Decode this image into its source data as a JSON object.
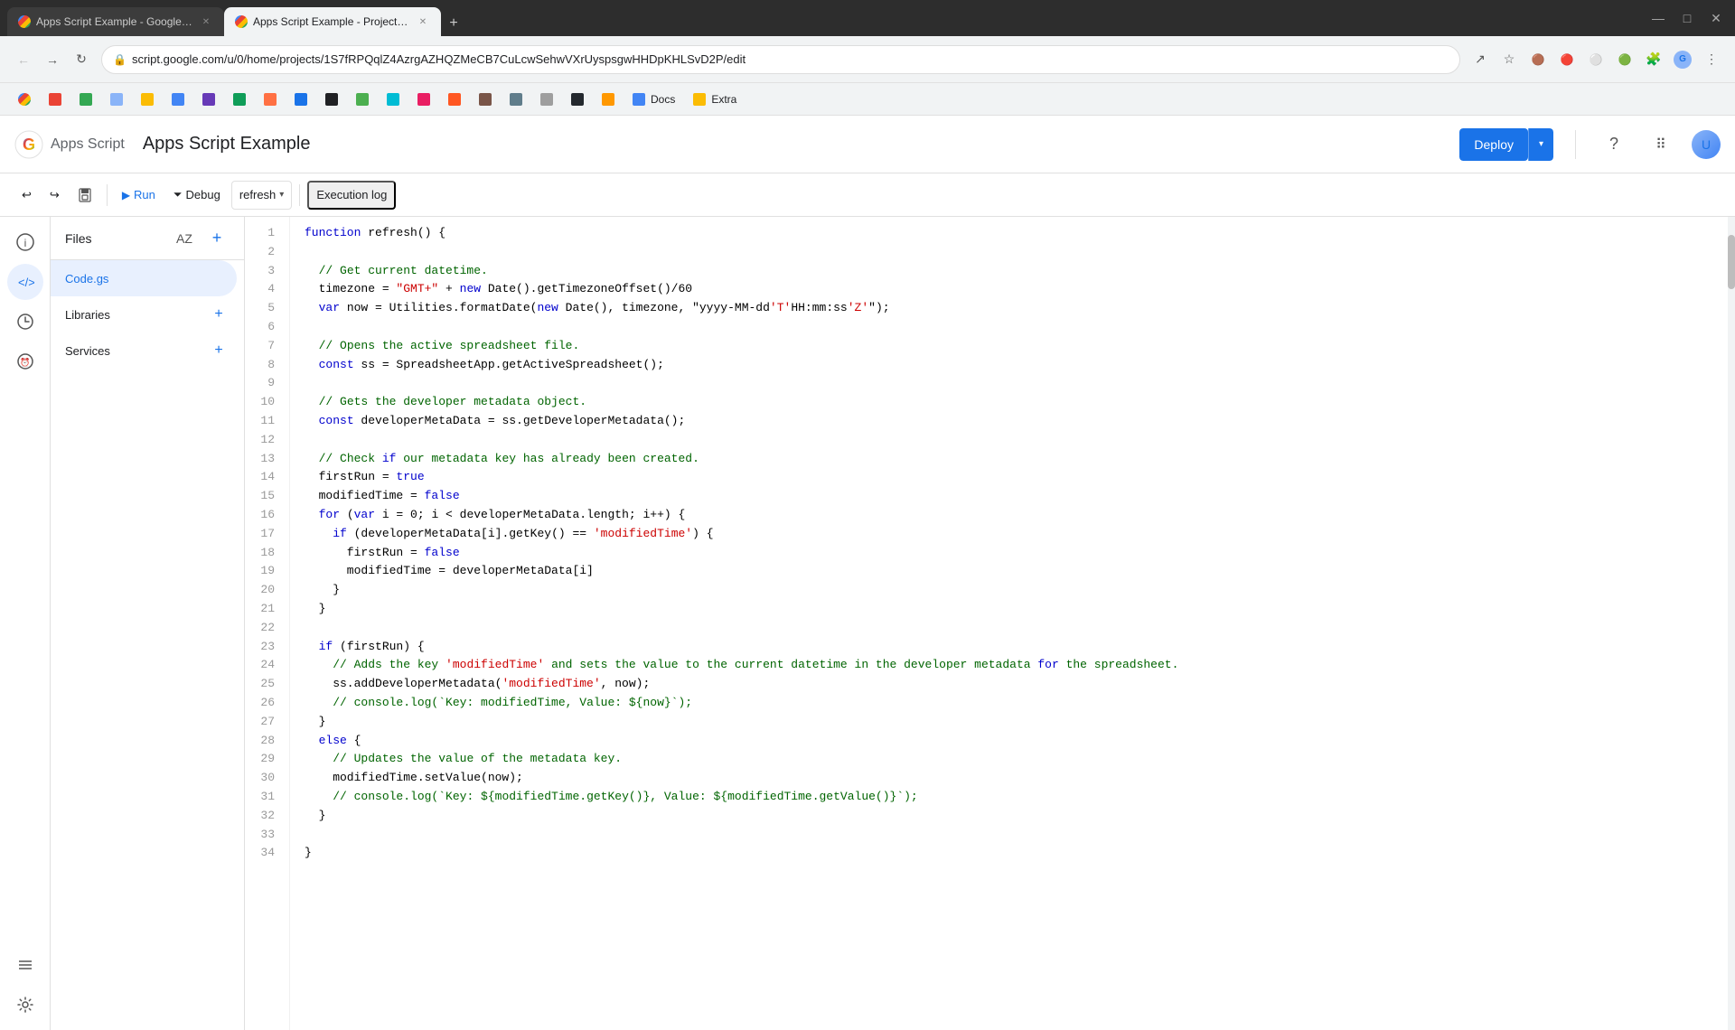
{
  "browser": {
    "tabs": [
      {
        "id": "tab1",
        "title": "Apps Script Example - Google S...",
        "favicon_color": "#4285f4",
        "active": false
      },
      {
        "id": "tab2",
        "title": "Apps Script Example - Project E...",
        "favicon_color": "#4285f4",
        "active": true
      }
    ],
    "address": "script.google.com/u/0/home/projects/1S7fRPQqlZ4AzrgAZHQZMeCB7CuLcwSehwVXrUyspsgwHHDpKHLSvD2P/edit",
    "bookmarks": [
      {
        "label": "Docs",
        "id": "bm-docs"
      },
      {
        "label": "Extra",
        "id": "bm-extra"
      }
    ]
  },
  "header": {
    "app_name": "Apps Script",
    "project_name": "Apps Script Example",
    "deploy_label": "Deploy",
    "deploy_dropdown_label": "▾"
  },
  "toolbar": {
    "undo_label": "↩",
    "redo_label": "↪",
    "save_label": "💾",
    "run_label": "Run",
    "debug_label": "Debug",
    "function_name": "refresh",
    "execution_log_label": "Execution log"
  },
  "sidebar": {
    "icons": [
      {
        "id": "info-icon",
        "symbol": "ℹ",
        "active": false
      },
      {
        "id": "code-icon",
        "symbol": "</>",
        "active": true
      },
      {
        "id": "history-icon",
        "symbol": "⏱",
        "active": false
      },
      {
        "id": "trigger-icon",
        "symbol": "⏰",
        "active": false
      },
      {
        "id": "list-icon",
        "symbol": "≡",
        "active": false
      },
      {
        "id": "settings-icon",
        "symbol": "⚙",
        "active": false
      }
    ]
  },
  "files_panel": {
    "title": "Files",
    "files": [
      {
        "id": "code-gs",
        "label": "Code.gs",
        "active": true
      }
    ],
    "sections": [
      {
        "id": "libraries",
        "label": "Libraries"
      },
      {
        "id": "services",
        "label": "Services"
      }
    ]
  },
  "code": {
    "lines": [
      {
        "num": 1,
        "text": "function refresh() {"
      },
      {
        "num": 2,
        "text": ""
      },
      {
        "num": 3,
        "text": "  // Get current datetime."
      },
      {
        "num": 4,
        "text": "  timezone = \"GMT+\" + new Date().getTimezoneOffset()/60"
      },
      {
        "num": 5,
        "text": "  var now = Utilities.formatDate(new Date(), timezone, \"yyyy-MM-dd'T'HH:mm:ss'Z'\");"
      },
      {
        "num": 6,
        "text": ""
      },
      {
        "num": 7,
        "text": "  // Opens the active spreadsheet file."
      },
      {
        "num": 8,
        "text": "  const ss = SpreadsheetApp.getActiveSpreadsheet();"
      },
      {
        "num": 9,
        "text": ""
      },
      {
        "num": 10,
        "text": "  // Gets the developer metadata object."
      },
      {
        "num": 11,
        "text": "  const developerMetaData = ss.getDeveloperMetadata();"
      },
      {
        "num": 12,
        "text": ""
      },
      {
        "num": 13,
        "text": "  // Check if our metadata key has already been created."
      },
      {
        "num": 14,
        "text": "  firstRun = true"
      },
      {
        "num": 15,
        "text": "  modifiedTime = false"
      },
      {
        "num": 16,
        "text": "  for (var i = 0; i < developerMetaData.length; i++) {"
      },
      {
        "num": 17,
        "text": "    if (developerMetaData[i].getKey() == 'modifiedTime') {"
      },
      {
        "num": 18,
        "text": "      firstRun = false"
      },
      {
        "num": 19,
        "text": "      modifiedTime = developerMetaData[i]"
      },
      {
        "num": 20,
        "text": "    }"
      },
      {
        "num": 21,
        "text": "  }"
      },
      {
        "num": 22,
        "text": ""
      },
      {
        "num": 23,
        "text": "  if (firstRun) {"
      },
      {
        "num": 24,
        "text": "    // Adds the key 'modifiedTime' and sets the value to the current datetime in the developer metadata for the spreadsheet."
      },
      {
        "num": 25,
        "text": "    ss.addDeveloperMetadata('modifiedTime', now);"
      },
      {
        "num": 26,
        "text": "    // console.log(`Key: modifiedTime, Value: ${now}`);"
      },
      {
        "num": 27,
        "text": "  }"
      },
      {
        "num": 28,
        "text": "  else {"
      },
      {
        "num": 29,
        "text": "    // Updates the value of the metadata key."
      },
      {
        "num": 30,
        "text": "    modifiedTime.setValue(now);"
      },
      {
        "num": 31,
        "text": "    // console.log(`Key: ${modifiedTime.getKey()}, Value: ${modifiedTime.getValue()}`);"
      },
      {
        "num": 32,
        "text": "  }"
      },
      {
        "num": 33,
        "text": ""
      },
      {
        "num": 34,
        "text": "}"
      }
    ]
  },
  "colors": {
    "keyword": "#0000cd",
    "comment": "#006400",
    "string": "#cc0000",
    "accent": "#1a73e8",
    "active_bg": "#e8f0fe"
  }
}
